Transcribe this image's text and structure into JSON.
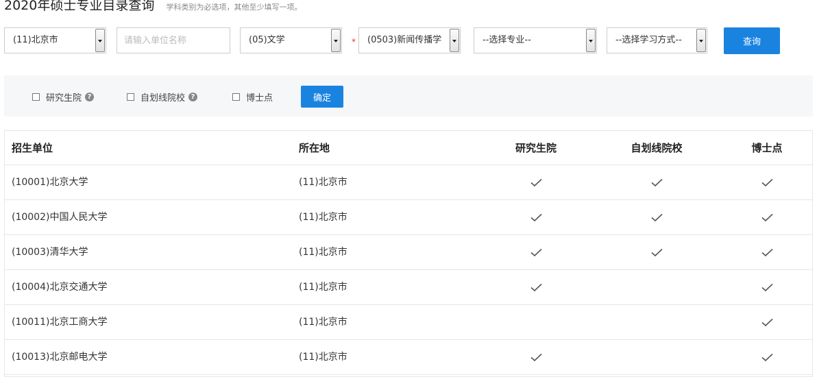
{
  "header": {
    "title": "2020年硕士专业目录查询",
    "hint": "学科类别为必选项，其他至少填写一项。"
  },
  "filters": {
    "province": "(11)北京市",
    "unit_placeholder": "请输入单位名称",
    "category": "(05)文学",
    "required_mark": "*",
    "discipline": "(0503)新闻传播学",
    "major": "--选择专业--",
    "study_mode": "--选择学习方式--",
    "query_label": "查询"
  },
  "options": {
    "graduate_school": "研究生院",
    "self_line": "自划线院校",
    "doctoral": "博士点",
    "help_glyph": "?",
    "confirm_label": "确定"
  },
  "table": {
    "columns": [
      "招生单位",
      "所在地",
      "研究生院",
      "自划线院校",
      "博士点"
    ],
    "rows": [
      {
        "unit": "(10001)北京大学",
        "location": "(11)北京市",
        "grad": true,
        "self_line": true,
        "doctoral": true
      },
      {
        "unit": "(10002)中国人民大学",
        "location": "(11)北京市",
        "grad": true,
        "self_line": true,
        "doctoral": true
      },
      {
        "unit": "(10003)清华大学",
        "location": "(11)北京市",
        "grad": true,
        "self_line": true,
        "doctoral": true
      },
      {
        "unit": "(10004)北京交通大学",
        "location": "(11)北京市",
        "grad": true,
        "self_line": false,
        "doctoral": true
      },
      {
        "unit": "(10011)北京工商大学",
        "location": "(11)北京市",
        "grad": false,
        "self_line": false,
        "doctoral": true
      },
      {
        "unit": "(10013)北京邮电大学",
        "location": "(11)北京市",
        "grad": true,
        "self_line": false,
        "doctoral": true
      }
    ]
  },
  "colors": {
    "accent": "#1a83e0",
    "required": "#ee3333",
    "filter_bg": "#f5f7f9"
  }
}
